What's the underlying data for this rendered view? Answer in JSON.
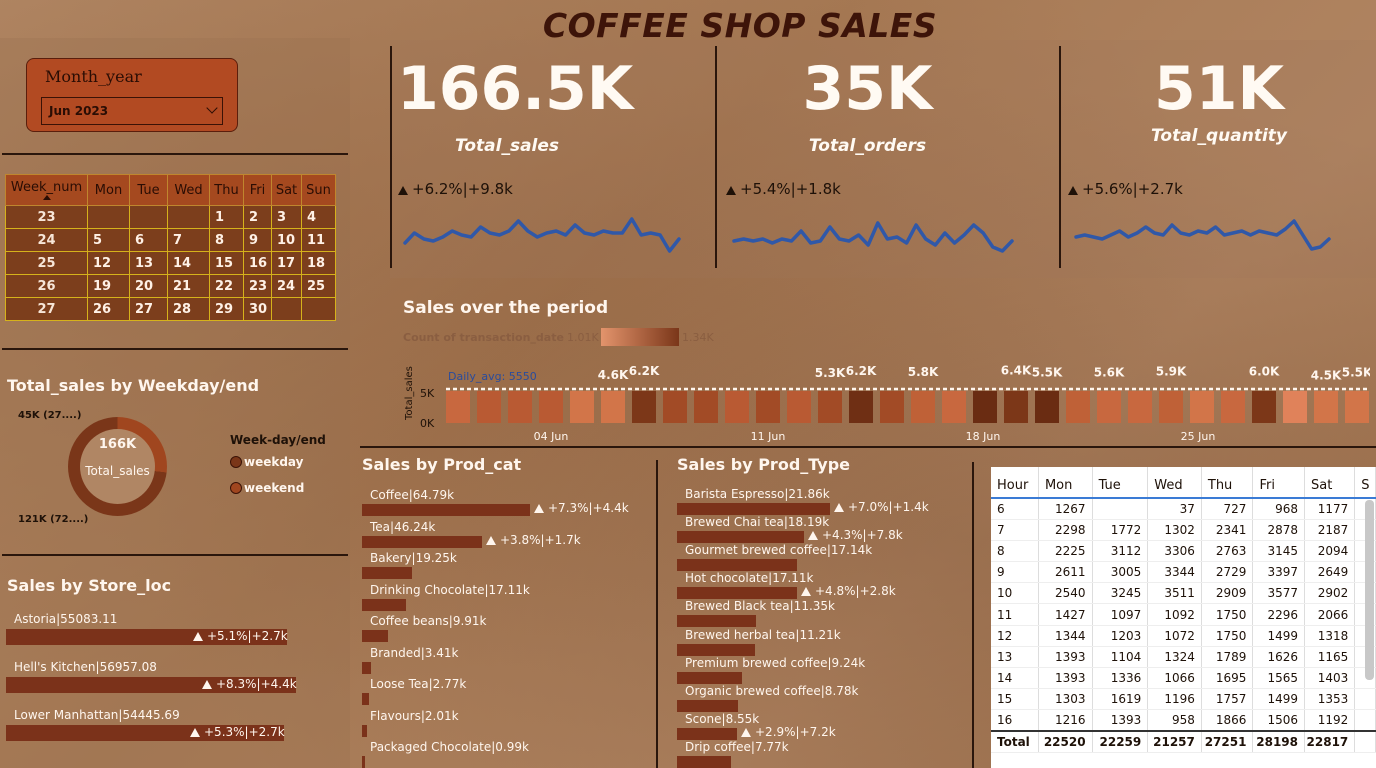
{
  "title": "COFFEE SHOP SALES",
  "slicer": {
    "title": "Month_year",
    "value": "Jun 2023"
  },
  "calendar": {
    "headers": [
      "Week_num",
      "Mon",
      "Tue",
      "Wed",
      "Thu",
      "Fri",
      "Sat",
      "Sun"
    ],
    "rows": [
      [
        "23",
        "",
        "",
        "",
        "1",
        "2",
        "3",
        "4"
      ],
      [
        "24",
        "5",
        "6",
        "7",
        "8",
        "9",
        "10",
        "11"
      ],
      [
        "25",
        "12",
        "13",
        "14",
        "15",
        "16",
        "17",
        "18"
      ],
      [
        "26",
        "19",
        "20",
        "21",
        "22",
        "23",
        "24",
        "25"
      ],
      [
        "27",
        "26",
        "27",
        "28",
        "29",
        "30",
        "",
        ""
      ]
    ]
  },
  "kpis": [
    {
      "value": "166.5K",
      "label": "Total_sales",
      "delta": "+6.2%|+9.8k"
    },
    {
      "value": "35K",
      "label": "Total_orders",
      "delta": "+5.4%|+1.8k"
    },
    {
      "value": "51K",
      "label": "Total_quantity",
      "delta": "+5.6%|+2.7k"
    }
  ],
  "weekday": {
    "title": "Total_sales by Weekday/end",
    "center_value": "166K",
    "center_label": "Total_sales",
    "label_top": "45K (27....)",
    "label_bottom": "121K (72....)",
    "legend_title": "Week-day/end",
    "legend": [
      "weekday",
      "weekend"
    ],
    "colors": {
      "weekday": "#7a3619",
      "weekend": "#a0461f"
    },
    "weekend_fraction": 0.27
  },
  "store": {
    "title": "Sales by Store_loc",
    "items": [
      {
        "label": "Astoria|55083.11",
        "delta": "+5.1%|+2.7k",
        "value": 55083.11
      },
      {
        "label": "Hell's Kitchen|56957.08",
        "delta": "+8.3%|+4.4k",
        "value": 56957.08
      },
      {
        "label": "Lower Manhattan|54445.69",
        "delta": "+5.3%|+2.7k",
        "value": 54445.69
      }
    ]
  },
  "period": {
    "title": "Sales over the period",
    "legend_label": "Count of transaction_date",
    "legend_min": "1.01K",
    "legend_max": "1.34K",
    "avg_label": "Daily_avg: 5550",
    "ylabel": "Total_sales",
    "yticks": [
      "5K",
      "0K"
    ],
    "xticks": [
      "04 Jun",
      "11 Jun",
      "18 Jun",
      "25 Jun"
    ]
  },
  "prod_cat": {
    "title": "Sales by Prod_cat",
    "items": [
      {
        "label": "Coffee|64.79k",
        "value": 64.79,
        "delta": "+7.3%|+4.4k"
      },
      {
        "label": "Tea|46.24k",
        "value": 46.24,
        "delta": "+3.8%|+1.7k"
      },
      {
        "label": "Bakery|19.25k",
        "value": 19.25,
        "delta": ""
      },
      {
        "label": "Drinking Chocolate|17.11k",
        "value": 17.11,
        "delta": ""
      },
      {
        "label": "Coffee beans|9.91k",
        "value": 9.91,
        "delta": ""
      },
      {
        "label": "Branded|3.41k",
        "value": 3.41,
        "delta": ""
      },
      {
        "label": "Loose Tea|2.77k",
        "value": 2.77,
        "delta": ""
      },
      {
        "label": "Flavours|2.01k",
        "value": 2.01,
        "delta": ""
      },
      {
        "label": "Packaged Chocolate|0.99k",
        "value": 0.99,
        "delta": ""
      }
    ]
  },
  "prod_type": {
    "title": "Sales by Prod_Type",
    "items": [
      {
        "label": "Barista Espresso|21.86k",
        "value": 21.86,
        "delta": "+7.0%|+1.4k"
      },
      {
        "label": "Brewed Chai tea|18.19k",
        "value": 18.19,
        "delta": "+4.3%|+7.8k"
      },
      {
        "label": "Gourmet brewed coffee|17.14k",
        "value": 17.14,
        "delta": ""
      },
      {
        "label": "Hot chocolate|17.11k",
        "value": 17.11,
        "delta": "+4.8%|+2.8k"
      },
      {
        "label": "Brewed Black tea|11.35k",
        "value": 11.35,
        "delta": ""
      },
      {
        "label": "Brewed herbal tea|11.21k",
        "value": 11.21,
        "delta": ""
      },
      {
        "label": "Premium brewed coffee|9.24k",
        "value": 9.24,
        "delta": ""
      },
      {
        "label": "Organic brewed coffee|8.78k",
        "value": 8.78,
        "delta": ""
      },
      {
        "label": "Scone|8.55k",
        "value": 8.55,
        "delta": "+2.9%|+7.2k"
      },
      {
        "label": "Drip coffee|7.77k",
        "value": 7.77,
        "delta": ""
      }
    ]
  },
  "matrix": {
    "headers": [
      "Hour",
      "Mon",
      "Tue",
      "Wed",
      "Thu",
      "Fri",
      "Sat",
      "S"
    ],
    "rows": [
      [
        "6",
        "1267",
        "",
        "37",
        "727",
        "968",
        "1177"
      ],
      [
        "7",
        "2298",
        "1772",
        "1302",
        "2341",
        "2878",
        "2187"
      ],
      [
        "8",
        "2225",
        "3112",
        "3306",
        "2763",
        "3145",
        "2094"
      ],
      [
        "9",
        "2611",
        "3005",
        "3344",
        "2729",
        "3397",
        "2649"
      ],
      [
        "10",
        "2540",
        "3245",
        "3511",
        "2909",
        "3577",
        "2902"
      ],
      [
        "11",
        "1427",
        "1097",
        "1092",
        "1750",
        "2296",
        "2066"
      ],
      [
        "12",
        "1344",
        "1203",
        "1072",
        "1750",
        "1499",
        "1318"
      ],
      [
        "13",
        "1393",
        "1104",
        "1324",
        "1789",
        "1626",
        "1165"
      ],
      [
        "14",
        "1393",
        "1336",
        "1066",
        "1695",
        "1565",
        "1403"
      ],
      [
        "15",
        "1303",
        "1619",
        "1196",
        "1757",
        "1499",
        "1353"
      ],
      [
        "16",
        "1216",
        "1393",
        "958",
        "1866",
        "1506",
        "1192"
      ]
    ],
    "total": [
      "Total",
      "22520",
      "22259",
      "21257",
      "27251",
      "28198",
      "22817"
    ]
  },
  "chart_data": [
    {
      "type": "bar",
      "title": "Sales over the period",
      "ylabel": "Total_sales",
      "ylim": [
        0,
        6500
      ],
      "x": [
        "1",
        "2",
        "3",
        "4",
        "5",
        "6",
        "7",
        "8",
        "9",
        "10",
        "11",
        "12",
        "13",
        "14",
        "15",
        "16",
        "17",
        "18",
        "19",
        "20",
        "21",
        "22",
        "23",
        "24",
        "25",
        "26",
        "27",
        "28",
        "29",
        "30"
      ],
      "values": [
        5200,
        5300,
        5250,
        5350,
        5450,
        4600,
        6200,
        5400,
        5300,
        5350,
        5300,
        5350,
        5300,
        6200,
        5400,
        5800,
        5200,
        5300,
        6400,
        5500,
        5400,
        5600,
        5300,
        5900,
        5400,
        5300,
        6000,
        5200,
        4500,
        5500
      ],
      "data_labels": {
        "6": "4.6K",
        "7": "6.2K",
        "13": "5.3K",
        "14": "6.2K",
        "16": "5.8K",
        "19": "6.4K",
        "20": "5.5K",
        "22": "5.6K",
        "24": "5.9K",
        "27": "6.0K",
        "29": "4.5K",
        "30": "5.5K"
      },
      "reference_line": {
        "label": "Daily_avg: 5550",
        "value": 5550
      },
      "color_by": "Count of transaction_date",
      "color_range": [
        "1.01K",
        "1.34K"
      ]
    },
    {
      "type": "pie",
      "title": "Total_sales by Weekday/end",
      "categories": [
        "weekend",
        "weekday"
      ],
      "values": [
        45,
        121
      ]
    },
    {
      "type": "line",
      "title": "Total_sales",
      "values": [
        0.3,
        0.55,
        0.4,
        0.35,
        0.45,
        0.6,
        0.5,
        0.45,
        0.7,
        0.55,
        0.5,
        0.6,
        0.85,
        0.6,
        0.45,
        0.55,
        0.6,
        0.5,
        0.75,
        0.55,
        0.5,
        0.6,
        0.55,
        0.55,
        0.9,
        0.5,
        0.55,
        0.5,
        0.1,
        0.4
      ],
      "color": "#3058a8"
    },
    {
      "type": "line",
      "title": "Total_orders",
      "values": [
        0.35,
        0.4,
        0.35,
        0.4,
        0.3,
        0.4,
        0.35,
        0.6,
        0.3,
        0.35,
        0.7,
        0.4,
        0.35,
        0.5,
        0.25,
        0.8,
        0.4,
        0.45,
        0.3,
        0.75,
        0.4,
        0.25,
        0.55,
        0.3,
        0.5,
        0.75,
        0.55,
        0.2,
        0.1,
        0.35
      ],
      "color": "#3058a8"
    },
    {
      "type": "line",
      "title": "Total_quantity",
      "values": [
        0.45,
        0.5,
        0.45,
        0.4,
        0.5,
        0.6,
        0.45,
        0.55,
        0.7,
        0.55,
        0.5,
        0.75,
        0.55,
        0.5,
        0.6,
        0.55,
        0.7,
        0.5,
        0.55,
        0.6,
        0.5,
        0.6,
        0.55,
        0.5,
        0.65,
        0.85,
        0.5,
        0.15,
        0.2,
        0.4
      ],
      "color": "#3058a8"
    }
  ]
}
